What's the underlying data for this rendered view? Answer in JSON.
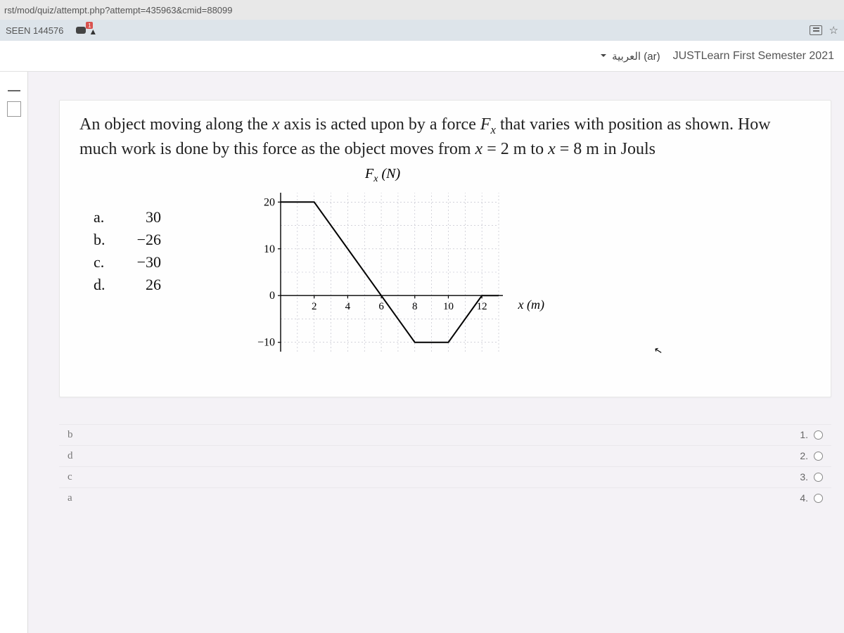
{
  "browser": {
    "url_fragment": "rst/mod/quiz/attempt.php?attempt=435963&cmid=88099",
    "tab_title": "SEEN 144576",
    "notification_count": "1"
  },
  "header": {
    "language_label": "العربية (ar)",
    "site_title": "JUSTLearn First Semester 2021"
  },
  "question": {
    "text_part1": "An object moving along the ",
    "text_italic_x": "x",
    "text_part2": " axis is acted upon by a force ",
    "text_fx_f": "F",
    "text_fx_sub": "x",
    "text_part3": " that varies with position as shown. How much work is done by this force as the object moves from ",
    "text_x1": "x",
    "text_eq1": " = 2 m to ",
    "text_x2": "x",
    "text_eq2": " = 8 m in Jouls"
  },
  "answer_choices": [
    {
      "letter": "a.",
      "value": "30"
    },
    {
      "letter": "b.",
      "value": "−26"
    },
    {
      "letter": "c.",
      "value": "−30"
    },
    {
      "letter": "d.",
      "value": "26"
    }
  ],
  "chart_data": {
    "type": "line",
    "title": "Fₓ (N)",
    "xlabel": "x (m)",
    "ylabel": "",
    "x_ticks": [
      2,
      4,
      6,
      8,
      10,
      12
    ],
    "y_ticks": [
      -10,
      0,
      10,
      20
    ],
    "xlim": [
      0,
      13
    ],
    "ylim": [
      -12,
      22
    ],
    "series": [
      {
        "name": "Fx",
        "x": [
          0,
          2,
          8,
          10,
          12,
          13
        ],
        "values": [
          20,
          20,
          -10,
          -10,
          0,
          0
        ]
      }
    ]
  },
  "radio_options": [
    {
      "letter": "b",
      "num": ".1"
    },
    {
      "letter": "d",
      "num": ".2"
    },
    {
      "letter": "c",
      "num": ".3"
    },
    {
      "letter": "a",
      "num": ".4"
    }
  ]
}
